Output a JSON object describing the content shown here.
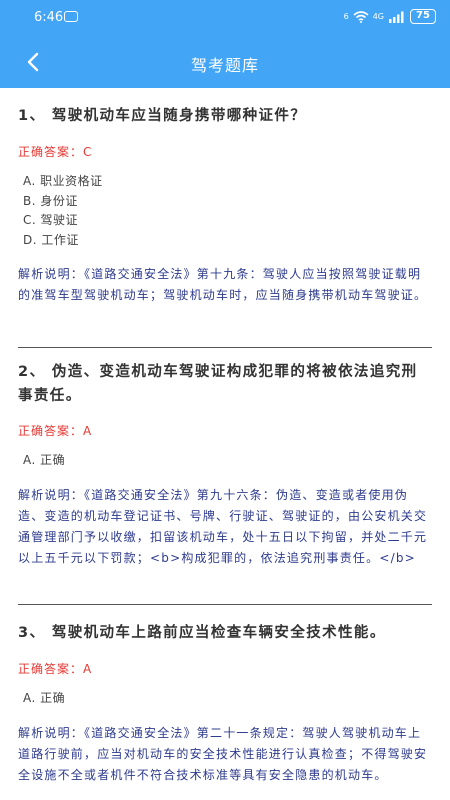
{
  "status": {
    "time": "6:46",
    "network_1": "6",
    "network_2": "4G",
    "battery": "75"
  },
  "header": {
    "title": "驾考题库"
  },
  "questions": [
    {
      "title": "1、 驾驶机动车应当随身携带哪种证件？",
      "answer_label": "正确答案：",
      "answer": "C",
      "options": [
        "A. 职业资格证",
        "B. 身份证",
        "C. 驾驶证",
        "D. 工作证"
      ],
      "explanation": "解析说明：《道路交通安全法》第十九条：驾驶人应当按照驾驶证载明的准驾车型驾驶机动车；驾驶机动车时，应当随身携带机动车驾驶证。"
    },
    {
      "title": "2、 伪造、变造机动车驾驶证构成犯罪的将被依法追究刑事责任。",
      "answer_label": "正确答案：",
      "answer": "A",
      "options": [
        "A. 正确"
      ],
      "explanation": "解析说明：《道路交通安全法》第九十六条：伪造、变造或者使用伪造、变造的机动车登记证书、号牌、行驶证、驾驶证的，由公安机关交通管理部门予以收缴，扣留该机动车，处十五日以下拘留，并处二千元以上五千元以下罚款；<b>构成犯罪的，依法追究刑事责任。</b>"
    },
    {
      "title": "3、 驾驶机动车上路前应当检查车辆安全技术性能。",
      "answer_label": "正确答案：",
      "answer": "A",
      "options": [
        "A. 正确"
      ],
      "explanation": "解析说明：《道路交通安全法》第二十一条规定：驾驶人驾驶机动车上道路行驶前，应当对机动车的安全技术性能进行认真检查；不得驾驶安全设施不全或者机件不符合技术标准等具有安全隐患的机动车。"
    }
  ]
}
